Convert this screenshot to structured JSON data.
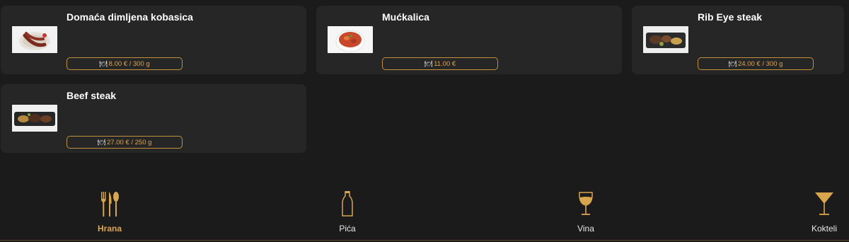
{
  "menu_items": [
    {
      "name": "Domaća dimljena kobasica",
      "price_icon": "plate-cutlery-icon",
      "price": "8.00 € / 300 g"
    },
    {
      "name": "Mućkalica",
      "price_icon": "plate-cutlery-icon",
      "price": "11.00 €"
    },
    {
      "name": "Rib Eye steak",
      "price_icon": "plate-cutlery-icon",
      "price": "24.00 € / 300 g"
    },
    {
      "name": "Beef steak",
      "price_icon": "plate-cutlery-icon",
      "price": "27.00 € / 250 g"
    }
  ],
  "nav": {
    "active": "Hrana",
    "items": [
      {
        "label": "Hrana",
        "icon": "fork-knife-spoon-icon"
      },
      {
        "label": "Pića",
        "icon": "bottle-icon"
      },
      {
        "label": "Vina",
        "icon": "wine-glass-icon"
      },
      {
        "label": "Kokteli",
        "icon": "cocktail-glass-icon"
      }
    ]
  },
  "colors": {
    "background": "#1b1b1b",
    "card": "#262626",
    "accent": "#d9a54d",
    "text": "#ffffff"
  }
}
